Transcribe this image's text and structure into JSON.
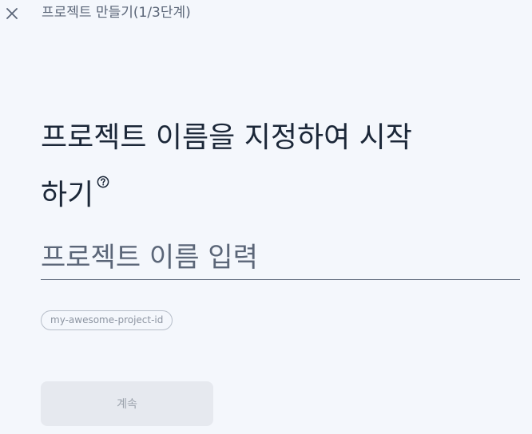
{
  "header": {
    "close_icon": "close-icon",
    "step_title": "프로젝트 만들기(1/3단계)"
  },
  "main": {
    "heading": "프로젝트 이름을 지정하여 시작하기",
    "help_icon": "help-circle-icon",
    "name_input": {
      "value": "",
      "placeholder": "프로젝트 이름 입력"
    },
    "project_id_chip": "my-awesome-project-id",
    "continue_button": {
      "label": "계속",
      "disabled": true
    }
  },
  "colors": {
    "background": "#f4f7fc",
    "heading_text": "#1b2738",
    "muted_text": "#5b6678",
    "button_disabled_bg": "#e6e9ef",
    "button_disabled_text": "#9aa1ab"
  }
}
